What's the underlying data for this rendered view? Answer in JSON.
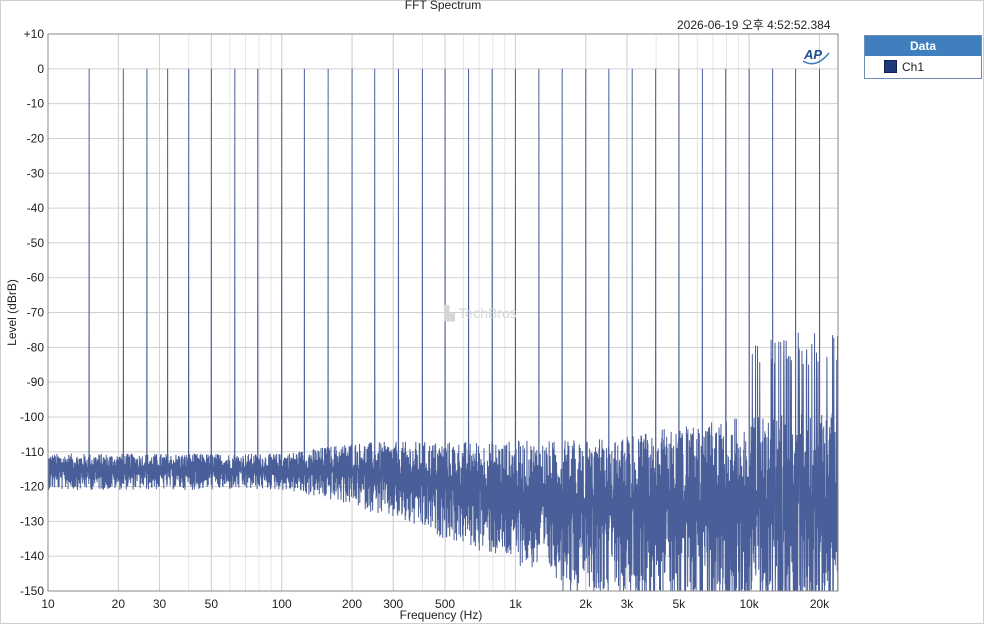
{
  "window": {
    "title": "FFT Spectrum",
    "timestamp": "2026-06-19 오후 4:52:52.384",
    "watermark": "TechBros",
    "logo": "AP"
  },
  "legend": {
    "header": "Data",
    "items": [
      {
        "name": "Ch1",
        "color": "#1e3a78"
      }
    ]
  },
  "colors": {
    "trace": "#4a5f9a",
    "grid": "#d9d9d9",
    "accent": "#3f7fbd"
  },
  "chart_data": {
    "type": "line",
    "title": "FFT Spectrum",
    "xlabel": "Frequency (Hz)",
    "ylabel": "Level (dBrB)",
    "x_scale": "log",
    "xlim": [
      10,
      24000
    ],
    "ylim": [
      -150,
      10
    ],
    "grid": true,
    "legend_position": "top-right, outside plot",
    "x_ticks": [
      {
        "value": 10,
        "label": "10"
      },
      {
        "value": 20,
        "label": "20"
      },
      {
        "value": 30,
        "label": "30"
      },
      {
        "value": 50,
        "label": "50"
      },
      {
        "value": 100,
        "label": "100"
      },
      {
        "value": 200,
        "label": "200"
      },
      {
        "value": 300,
        "label": "300"
      },
      {
        "value": 500,
        "label": "500"
      },
      {
        "value": 1000,
        "label": "1k"
      },
      {
        "value": 2000,
        "label": "2k"
      },
      {
        "value": 3000,
        "label": "3k"
      },
      {
        "value": 5000,
        "label": "5k"
      },
      {
        "value": 10000,
        "label": "10k"
      },
      {
        "value": 20000,
        "label": "20k"
      }
    ],
    "y_ticks": [
      {
        "value": 10,
        "label": "+10"
      },
      {
        "value": 0,
        "label": "0"
      },
      {
        "value": -10,
        "label": "-10"
      },
      {
        "value": -20,
        "label": "-20"
      },
      {
        "value": -30,
        "label": "-30"
      },
      {
        "value": -40,
        "label": "-40"
      },
      {
        "value": -50,
        "label": "-50"
      },
      {
        "value": -60,
        "label": "-60"
      },
      {
        "value": -70,
        "label": "-70"
      },
      {
        "value": -80,
        "label": "-80"
      },
      {
        "value": -90,
        "label": "-90"
      },
      {
        "value": -100,
        "label": "-100"
      },
      {
        "value": -110,
        "label": "-110"
      },
      {
        "value": -120,
        "label": "-120"
      },
      {
        "value": -130,
        "label": "-130"
      },
      {
        "value": -140,
        "label": "-140"
      },
      {
        "value": -150,
        "label": "-150"
      }
    ],
    "series": [
      {
        "name": "Ch1",
        "tone_frequencies_hz": [
          15,
          21,
          26.5,
          32.5,
          40,
          50,
          63,
          79,
          100,
          125,
          158,
          200,
          250,
          316,
          400,
          500,
          630,
          795,
          1000,
          1260,
          1585,
          2000,
          2510,
          3160,
          3980,
          5010,
          6310,
          7940,
          10000,
          12600,
          15800,
          20000
        ],
        "tone_level_db": 0,
        "noise_floor_db": {
          "low_freq": -115,
          "mid_freq": -125,
          "high_freq_peaks": -80
        }
      }
    ]
  }
}
